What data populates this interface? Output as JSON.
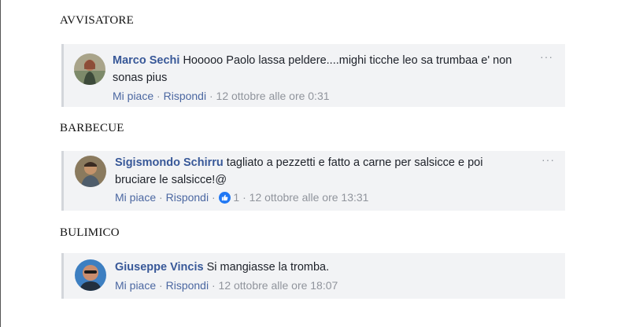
{
  "headings": [
    "AVVISATORE",
    "BARBECUE",
    "BULIMICO"
  ],
  "comments": [
    {
      "author": "Marco Sechi",
      "text": "Hooooo Paolo lassa peldere....mighi ticche leo sa trumbaa e' non sonas pius",
      "like": "Mi piace",
      "reply": "Rispondi",
      "sep": "·",
      "timestamp": "12 ottobre alle ore 0:31",
      "more": "···"
    },
    {
      "author": "Sigismondo Schirru",
      "text": "tagliato a pezzetti e fatto a carne per salsicce e poi bruciare le salsicce!@",
      "like": "Mi piace",
      "reply": "Rispondi",
      "sep": "·",
      "reaction_count": "1",
      "timestamp": "12 ottobre alle ore 13:31",
      "more": "···"
    },
    {
      "author": "Giuseppe Vincis",
      "text": "Si mangiasse la tromba.",
      "like": "Mi piace",
      "reply": "Rispondi",
      "sep": "·",
      "timestamp": "12 ottobre alle ore 18:07"
    }
  ],
  "colors": {
    "author": "#385898",
    "link": "#4b67a1",
    "meta": "#90949c",
    "card_bg": "#f2f3f5",
    "like_badge": "#2078f4"
  },
  "icons": [
    "thumbs-up-icon",
    "more-options-icon"
  ]
}
